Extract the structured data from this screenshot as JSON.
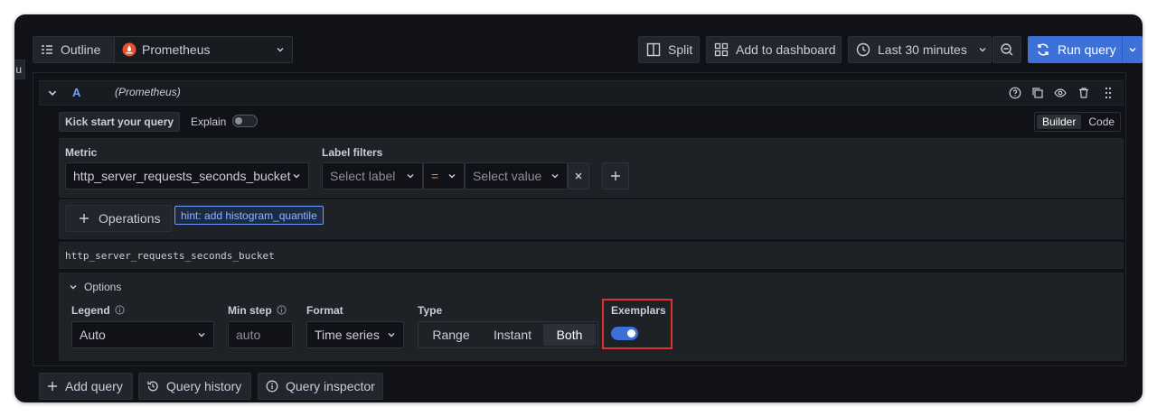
{
  "toolbar": {
    "outline_label": "Outline",
    "datasource_name": "Prometheus",
    "split_label": "Split",
    "add_to_dashboard_label": "Add to dashboard",
    "time_range_label": "Last 30 minutes",
    "run_query_label": "Run query",
    "left_tab_fragment": "u"
  },
  "query": {
    "ref_id": "A",
    "datasource_hint": "(Prometheus)",
    "kick_start_label": "Kick start your query",
    "explain_label": "Explain",
    "explain_enabled": false,
    "mode_tabs": [
      "Builder",
      "Code"
    ],
    "active_mode": "Builder",
    "metric_label": "Metric",
    "metric_value": "http_server_requests_seconds_bucket",
    "label_filters_label": "Label filters",
    "select_label_placeholder": "Select label",
    "operator": "=",
    "select_value_placeholder": "Select value",
    "operations_label": "Operations",
    "hint_text": "hint: add histogram_quantile",
    "raw_query": "http_server_requests_seconds_bucket",
    "options_label": "Options",
    "legend_label": "Legend",
    "legend_value": "Auto",
    "min_step_label": "Min step",
    "min_step_placeholder": "auto",
    "format_label": "Format",
    "format_value": "Time series",
    "type_label": "Type",
    "type_options": [
      "Range",
      "Instant",
      "Both"
    ],
    "type_selected": "Both",
    "exemplars_label": "Exemplars",
    "exemplars_enabled": true
  },
  "footer": {
    "add_query_label": "Add query",
    "query_history_label": "Query history",
    "query_inspector_label": "Query inspector"
  },
  "colors": {
    "accent": "#3d71d9",
    "highlight": "#e02f2f",
    "operator": "#ff8833"
  }
}
